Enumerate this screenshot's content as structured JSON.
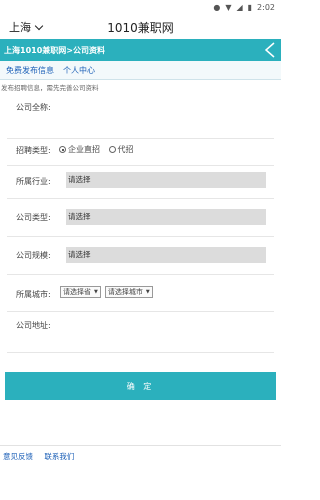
{
  "status_bar": {
    "time": "2:02"
  },
  "app_bar": {
    "city": "上海",
    "title": "1010兼职网"
  },
  "breadcrumb": "上海1010兼职网>公司资料",
  "subnav": {
    "publish": "免费发布信息",
    "personal": "个人中心"
  },
  "notice": "发布招聘信息，需先完善公司资料",
  "form": {
    "company_name_label": "公司全称:",
    "recruit_type_label": "招聘类型:",
    "recruit_option_direct": "企业直招",
    "recruit_option_agent": "代招",
    "industry_label": "所属行业:",
    "industry_value": "请选择",
    "company_type_label": "公司类型:",
    "company_type_value": "请选择",
    "company_size_label": "公司规模:",
    "company_size_value": "请选择",
    "city_label": "所属城市:",
    "province_select": "请选择省",
    "city_select": "请选择城市",
    "address_label": "公司地址:"
  },
  "submit_label": "确 定",
  "footer": {
    "feedback": "意见反馈",
    "contact": "联系我们"
  }
}
